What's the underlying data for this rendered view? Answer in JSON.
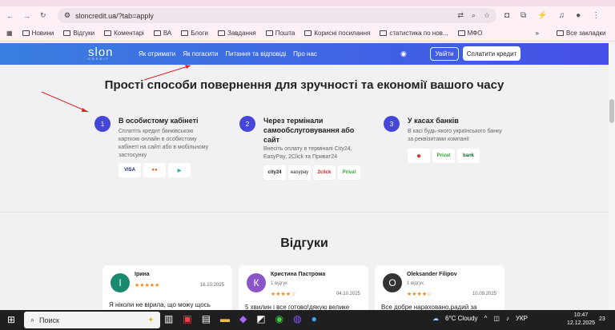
{
  "browser": {
    "url": "sloncredit.ua/?tab=apply",
    "bookmarks": [
      "Новини",
      "Відгуки",
      "Коментарі",
      "ВА",
      "Блоги",
      "Завдання",
      "Пошта",
      "Корисні посилання",
      "статистика по нов...",
      "МФО"
    ],
    "all_bookmarks": "Все закладки",
    "overflow": "»"
  },
  "nav": {
    "logo": "slon",
    "logo_sub": "CREDIT",
    "links": [
      "Як отримати",
      "Як погасити",
      "Питання та відповіді",
      "Про нас"
    ],
    "login": "Увійти",
    "pay": "Сплатити кредит"
  },
  "repay": {
    "title": "Прості способи повернення для зручності та економії вашого часу",
    "steps": [
      {
        "num": "1",
        "title": "В особистому кабінеті",
        "desc": "Сплатіть кредит банківською карткою онлайн в особистому кабінеті на сайті або в мобільному застосунку",
        "logos": [
          "VISA",
          "●●",
          "▶"
        ]
      },
      {
        "num": "2",
        "title": "Через термінали самообслуговування або сайт",
        "desc": "Внесіть оплату в терміналі City24, EasyPay, 2Click та Приват24",
        "logos": [
          "city24",
          "easypay",
          "2click",
          "Privat"
        ]
      },
      {
        "num": "3",
        "title": "У касах банків",
        "desc": "В касі будь-якого українського банку за реквізитами компанії",
        "logos": [
          "●",
          "Privat",
          "bank"
        ]
      }
    ]
  },
  "reviews": {
    "title": "Відгуки",
    "items": [
      {
        "initial": "І",
        "name": "Ірина",
        "count": "",
        "stars": "★★★★★",
        "date": "16.10.2025",
        "text": "Я ніколи не вірила, що можу щось",
        "color": "#1a8a6e"
      },
      {
        "initial": "К",
        "name": "Кристина Пастрома",
        "count": "1 відгук",
        "stars": "★★★★☆",
        "date": "04.10.2025",
        "text": "5 хвилин і все готово!дякую велике",
        "color": "#8a55c8"
      },
      {
        "initial": "O",
        "name": "Oleksander Filipov",
        "count": "1 відгук",
        "stars": "★★★★☆",
        "date": "10.09.2025",
        "text": "Все добре нараховано,радий за",
        "color": "#333"
      }
    ]
  },
  "taskbar": {
    "search": "Поиск",
    "weather": "6°C  Cloudy",
    "lang": "УКР",
    "time": "10:47",
    "date": "12.12.2025",
    "notif": "23"
  }
}
